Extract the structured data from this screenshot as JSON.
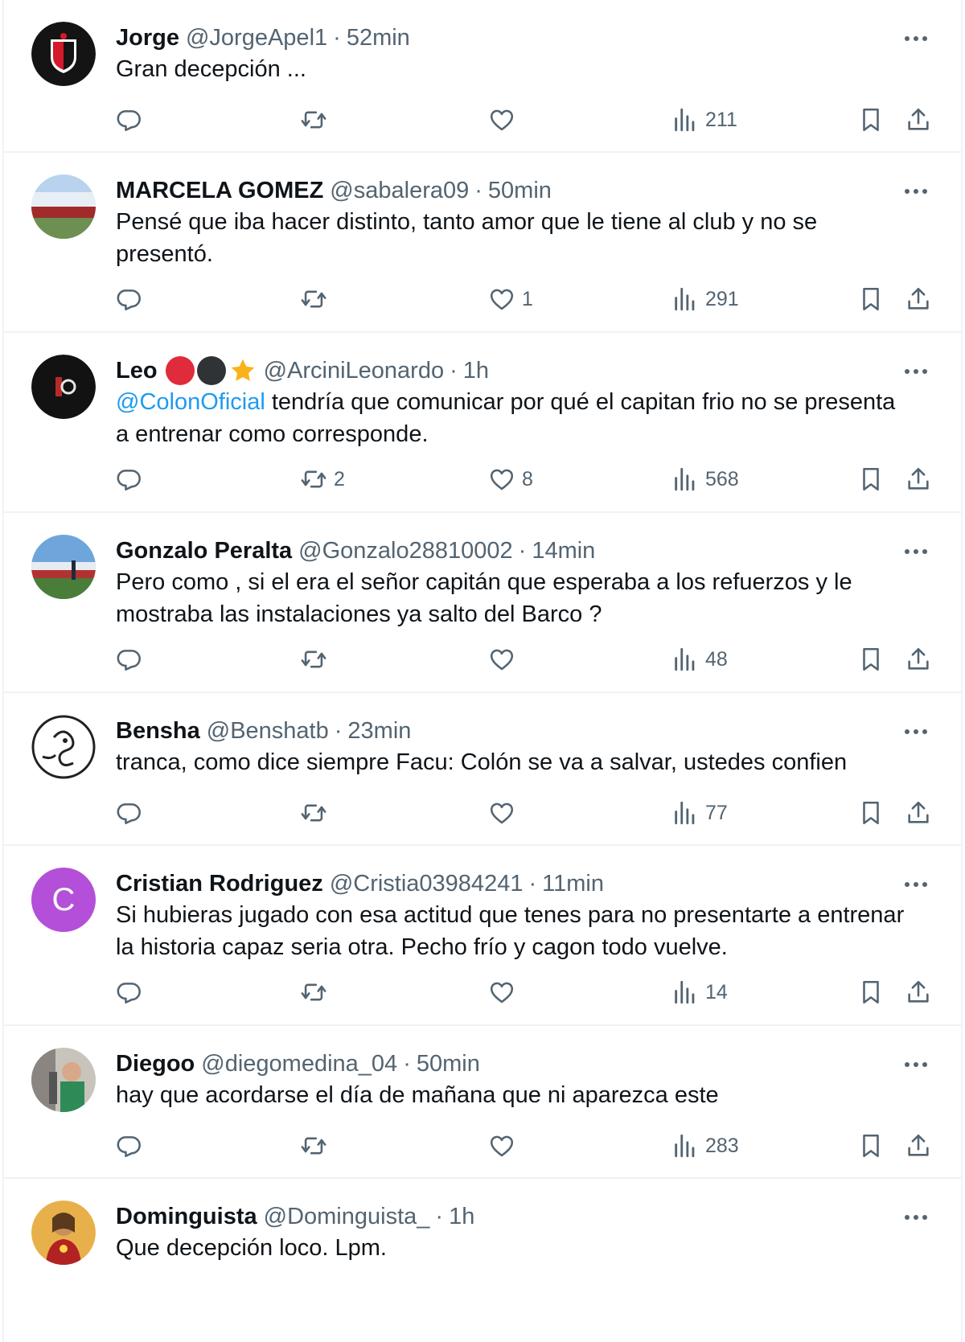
{
  "tweets": [
    {
      "name": "Jorge",
      "handle": "@JorgeApel1",
      "sep": "·",
      "time": "52min",
      "text": "Gran decepción ...",
      "retweets": "",
      "likes": "",
      "views": "211",
      "avatar": "colon-crest"
    },
    {
      "name": "MARCELA GOMEZ",
      "handle": "@sabalera09",
      "sep": "·",
      "time": "50min",
      "text": "Pensé que iba hacer distinto, tanto amor que le tiene al club y no se presentó.",
      "retweets": "",
      "likes": "1",
      "views": "291",
      "avatar": "stadium-photo"
    },
    {
      "name": "Leo",
      "badges": [
        "red-circle",
        "black-circle",
        "star"
      ],
      "handle": "@ArciniLeonardo",
      "sep": "·",
      "time": "1h",
      "mention": "@ColonOficial",
      "text": " tendría que comunicar por qué el capitan frio no se presenta a entrenar como corresponde.",
      "retweets": "2",
      "likes": "8",
      "views": "568",
      "avatar": "dark-logo"
    },
    {
      "name": "Gonzalo Peralta",
      "handle": "@Gonzalo28810002",
      "sep": "·",
      "time": "14min",
      "text": "Pero como , si el era el señor capitán que esperaba a los refuerzos y le mostraba las instalaciones ya salto del Barco ?",
      "retweets": "",
      "likes": "",
      "views": "48",
      "avatar": "stadium-photo"
    },
    {
      "name": "Bensha",
      "handle": "@Benshatb",
      "sep": "·",
      "time": "23min",
      "text": "tranca, como dice siempre Facu: Colón se va a salvar, ustedes confien",
      "retweets": "",
      "likes": "",
      "views": "77",
      "avatar": "sketch-drawing"
    },
    {
      "name": "Cristian Rodriguez",
      "handle": "@Cristia03984241",
      "sep": "·",
      "time": "11min",
      "text": "Si hubieras jugado con esa actitud que tenes para no presentarte a entrenar la historia capaz seria otra. Pecho frío y cagon todo vuelve.",
      "retweets": "",
      "likes": "",
      "views": "14",
      "avatar": "letter-avatar",
      "avatar_letter": "C",
      "avatar_color": "#b44fd9"
    },
    {
      "name": "Diegoo",
      "handle": "@diegomedina_04",
      "sep": "·",
      "time": "50min",
      "text": "hay que acordarse el día de mañana que ni aparezca este",
      "retweets": "",
      "likes": "",
      "views": "283",
      "avatar": "person-photo"
    },
    {
      "name": "Dominguista",
      "handle": "@Dominguista_",
      "sep": "·",
      "time": "1h",
      "text": "Que decepción loco. Lpm.",
      "avatar": "religious-portrait"
    }
  ],
  "colors": {
    "text": "#0f1419",
    "secondary": "#536471",
    "link": "#1d9bf0",
    "border": "#eff3f4"
  }
}
